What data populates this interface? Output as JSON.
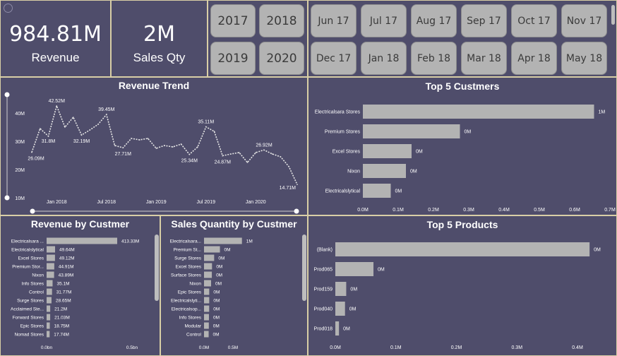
{
  "kpis": {
    "revenue": {
      "value": "984.81M",
      "label": "Revenue"
    },
    "sales_qty": {
      "value": "2M",
      "label": "Sales Qty"
    }
  },
  "year_slicer": [
    "2017",
    "2018",
    "2019",
    "2020"
  ],
  "month_slicer": [
    "Jun 17",
    "Jul 17",
    "Aug 17",
    "Sep 17",
    "Oct 17",
    "Nov 17",
    "Dec 17",
    "Jan 18",
    "Feb 18",
    "Mar 18",
    "Apr 18",
    "May 18"
  ],
  "titles": {
    "revenue_trend": "Revenue Trend",
    "top5_customers": "Top 5 Custmers",
    "revenue_by_customer": "Revenue by Custmer",
    "sales_qty_by_customer": "Sales Quantity by Custmer",
    "top5_products": "Top 5 Products"
  },
  "colors": {
    "tile_bg": "#4f4d6b",
    "border": "#d9cfa6",
    "bar": "#b3b3b3",
    "text": "#ffffff"
  },
  "chart_data": [
    {
      "id": "revenue_trend",
      "type": "line",
      "title": "Revenue Trend",
      "ylim": [
        10,
        45
      ],
      "y_ticks": [
        "10M",
        "20M",
        "30M",
        "40M"
      ],
      "x_ticks": [
        "Jan 2018",
        "Jul 2018",
        "Jan 2019",
        "Jul 2019",
        "Jan 2020"
      ],
      "x": [
        "Oct 2017",
        "Nov 2017",
        "Dec 2017",
        "Jan 2018",
        "Feb 2018",
        "Mar 2018",
        "Apr 2018",
        "May 2018",
        "Jun 2018",
        "Jul 2018",
        "Aug 2018",
        "Sep 2018",
        "Oct 2018",
        "Nov 2018",
        "Dec 2018",
        "Jan 2019",
        "Feb 2019",
        "Mar 2019",
        "Apr 2019",
        "May 2019",
        "Jun 2019",
        "Jul 2019",
        "Aug 2019",
        "Sep 2019",
        "Oct 2019",
        "Nov 2019",
        "Dec 2019",
        "Jan 2020",
        "Feb 2020",
        "Mar 2020",
        "Apr 2020",
        "May 2020",
        "Jun 2020"
      ],
      "values": [
        26.09,
        34.5,
        31.8,
        42.52,
        35.0,
        38.5,
        32.19,
        34.0,
        36.0,
        39.45,
        28.5,
        27.71,
        31.0,
        30.5,
        31.0,
        27.5,
        28.5,
        28.0,
        29.0,
        25.34,
        28.0,
        35.11,
        33.5,
        24.87,
        25.5,
        26.0,
        22.5,
        26.0,
        26.92,
        25.5,
        24.5,
        21.0,
        14.71
      ],
      "labels": [
        {
          "i": 0,
          "text": "26.09M"
        },
        {
          "i": 2,
          "text": "31.8M"
        },
        {
          "i": 3,
          "text": "42.52M"
        },
        {
          "i": 6,
          "text": "32.19M"
        },
        {
          "i": 9,
          "text": "39.45M"
        },
        {
          "i": 11,
          "text": "27.71M"
        },
        {
          "i": 19,
          "text": "25.34M"
        },
        {
          "i": 21,
          "text": "35.11M"
        },
        {
          "i": 23,
          "text": "24.87M"
        },
        {
          "i": 28,
          "text": "26.92M"
        },
        {
          "i": 32,
          "text": "14.71M"
        }
      ]
    },
    {
      "id": "top5_customers",
      "type": "bar",
      "title": "Top 5 Custmers",
      "categories": [
        "Electricalsara Stores",
        "Premium Stores",
        "Excel Stores",
        "Nixon",
        "Electricalslytical"
      ],
      "values": [
        0.655,
        0.275,
        0.138,
        0.122,
        0.079
      ],
      "data_labels": [
        "1M",
        "0M",
        "0M",
        "0M",
        "0M"
      ],
      "x_ticks": [
        "0.0M",
        "0.1M",
        "0.2M",
        "0.3M",
        "0.4M",
        "0.5M",
        "0.6M",
        "0.7M"
      ],
      "xlim": [
        0,
        0.7
      ]
    },
    {
      "id": "revenue_by_customer",
      "type": "bar",
      "title": "Revenue by Custmer",
      "categories": [
        "Electricalsara ...",
        "Electricalslytical",
        "Excel Stores",
        "Premium Stor...",
        "Nixon",
        "Info Stores",
        "Control",
        "Surge Stores",
        "Acclaimed Ste...",
        "Forward Stores",
        "Epic Stores",
        "Nomad Stores"
      ],
      "values": [
        413.33,
        49.64,
        49.12,
        44.91,
        43.89,
        35.1,
        31.77,
        28.65,
        21.2,
        21.03,
        18.75,
        17.74
      ],
      "data_labels": [
        "413.33M",
        "49.64M",
        "49.12M",
        "44.91M",
        "43.89M",
        "35.1M",
        "31.77M",
        "28.65M",
        "21.2M",
        "21.03M",
        "18.75M",
        "17.74M"
      ],
      "x_ticks": [
        "0.0bn",
        "0.5bn"
      ],
      "xlim": [
        0,
        500
      ]
    },
    {
      "id": "sales_qty_by_customer",
      "type": "bar",
      "title": "Sales Quantity by Custmer",
      "categories": [
        "Electricalsara...",
        "Premium St...",
        "Surge Stores",
        "Excel Stores",
        "Surface Stores",
        "Nixon",
        "Epic Stores",
        "Electricalslyti...",
        "Electricalsop...",
        "Info Stores",
        "Modular",
        "Control"
      ],
      "values": [
        0.655,
        0.275,
        0.175,
        0.138,
        0.135,
        0.122,
        0.09,
        0.09,
        0.089,
        0.085,
        0.083,
        0.08
      ],
      "data_labels": [
        "1M",
        "0M",
        "0M",
        "0M",
        "0M",
        "0M",
        "0M",
        "0M",
        "0M",
        "0M",
        "0M",
        "0M"
      ],
      "x_ticks": [
        "0.0M",
        "0.5M"
      ],
      "xlim": [
        0,
        1.0
      ]
    },
    {
      "id": "top5_products",
      "type": "bar",
      "title": "Top 5 Products",
      "categories": [
        "(Blank)",
        "Prod065",
        "Prod159",
        "Prod040",
        "Prod018"
      ],
      "values": [
        0.42,
        0.063,
        0.018,
        0.016,
        0.006
      ],
      "data_labels": [
        "0M",
        "0M",
        "0M",
        "0M",
        "0M"
      ],
      "x_ticks": [
        "0.0M",
        "0.1M",
        "0.2M",
        "0.3M",
        "0.4M"
      ],
      "xlim": [
        0,
        0.4
      ]
    }
  ]
}
